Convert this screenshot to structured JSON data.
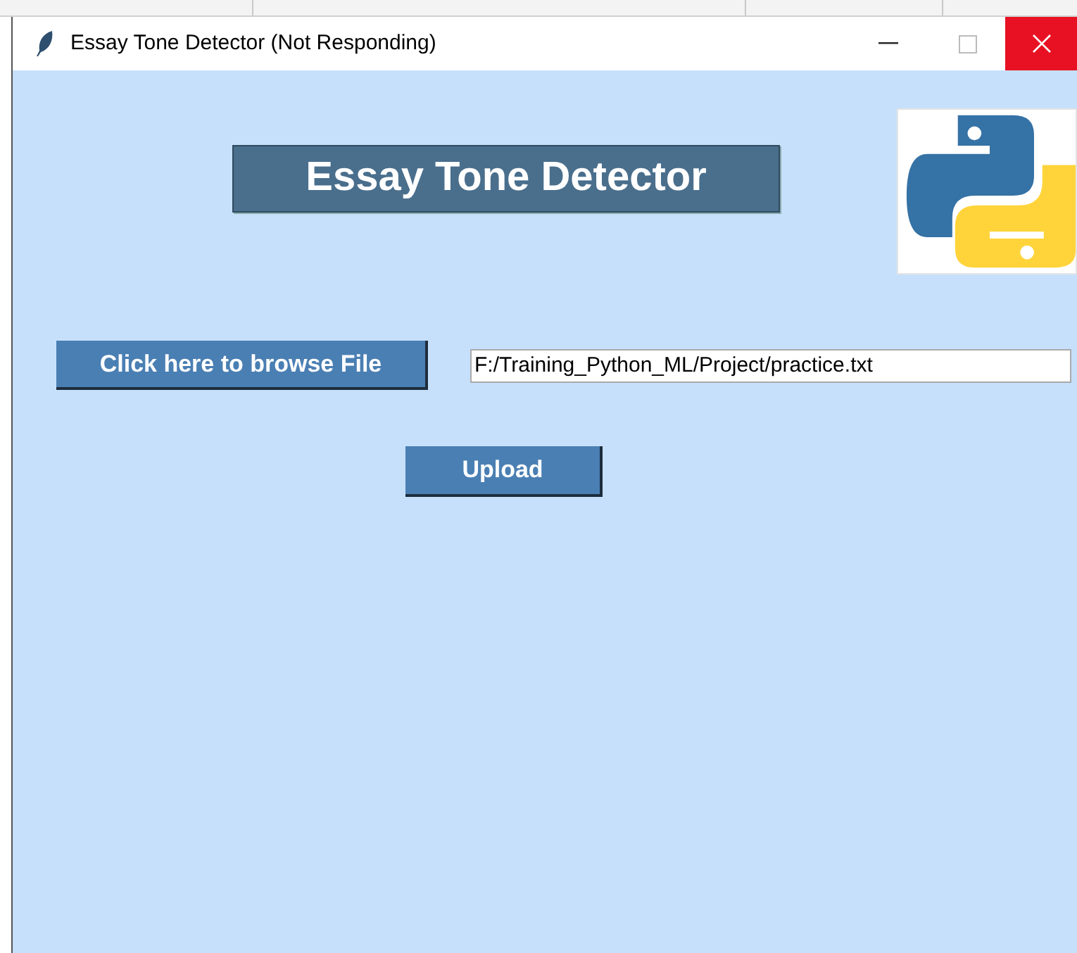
{
  "window": {
    "title": "Essay Tone Detector (Not Responding)"
  },
  "heading": "Essay Tone Detector",
  "browse_button": "Click here to browse File",
  "file_field": {
    "value": "F:/Training_Python_ML/Project/practice.txt"
  },
  "upload_button": "Upload"
}
